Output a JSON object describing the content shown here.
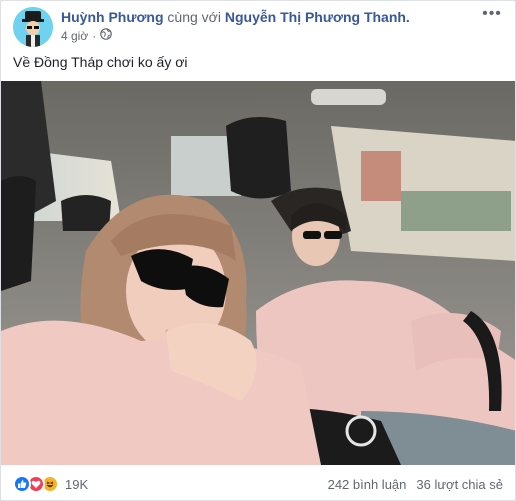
{
  "post": {
    "author": "Huỳnh Phương",
    "with_text": "cùng với",
    "tagged": "Nguyễn Thị Phương Thanh.",
    "time": "4 giờ",
    "privacy_icon": "globe-icon",
    "options_icon": "more-options-icon",
    "text": "Về Đồng Tháp chơi ko ấy ơi"
  },
  "photo": {
    "icon": "car-selfie-photo"
  },
  "footer": {
    "reactions": [
      "like-icon",
      "love-icon",
      "haha-icon"
    ],
    "reaction_count": "19K",
    "comments": "242 bình luận",
    "shares": "36 lượt chia sẻ"
  },
  "colors": {
    "link": "#385898",
    "like": "#1877f2",
    "love": "#f33e58",
    "haha": "#f7b125"
  }
}
